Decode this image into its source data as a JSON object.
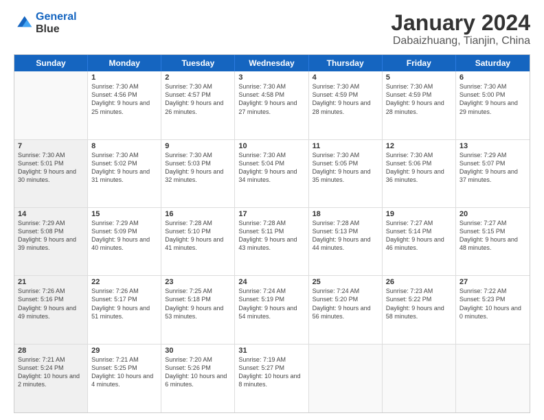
{
  "logo": {
    "line1": "General",
    "line2": "Blue"
  },
  "header": {
    "month": "January 2024",
    "location": "Dabaizhuang, Tianjin, China"
  },
  "weekdays": [
    "Sunday",
    "Monday",
    "Tuesday",
    "Wednesday",
    "Thursday",
    "Friday",
    "Saturday"
  ],
  "weeks": [
    [
      {
        "day": "",
        "sunrise": "",
        "sunset": "",
        "daylight": "",
        "empty": true
      },
      {
        "day": "1",
        "sunrise": "Sunrise: 7:30 AM",
        "sunset": "Sunset: 4:56 PM",
        "daylight": "Daylight: 9 hours and 25 minutes."
      },
      {
        "day": "2",
        "sunrise": "Sunrise: 7:30 AM",
        "sunset": "Sunset: 4:57 PM",
        "daylight": "Daylight: 9 hours and 26 minutes."
      },
      {
        "day": "3",
        "sunrise": "Sunrise: 7:30 AM",
        "sunset": "Sunset: 4:58 PM",
        "daylight": "Daylight: 9 hours and 27 minutes."
      },
      {
        "day": "4",
        "sunrise": "Sunrise: 7:30 AM",
        "sunset": "Sunset: 4:59 PM",
        "daylight": "Daylight: 9 hours and 28 minutes."
      },
      {
        "day": "5",
        "sunrise": "Sunrise: 7:30 AM",
        "sunset": "Sunset: 4:59 PM",
        "daylight": "Daylight: 9 hours and 28 minutes."
      },
      {
        "day": "6",
        "sunrise": "Sunrise: 7:30 AM",
        "sunset": "Sunset: 5:00 PM",
        "daylight": "Daylight: 9 hours and 29 minutes."
      }
    ],
    [
      {
        "day": "7",
        "sunrise": "Sunrise: 7:30 AM",
        "sunset": "Sunset: 5:01 PM",
        "daylight": "Daylight: 9 hours and 30 minutes.",
        "shaded": true
      },
      {
        "day": "8",
        "sunrise": "Sunrise: 7:30 AM",
        "sunset": "Sunset: 5:02 PM",
        "daylight": "Daylight: 9 hours and 31 minutes."
      },
      {
        "day": "9",
        "sunrise": "Sunrise: 7:30 AM",
        "sunset": "Sunset: 5:03 PM",
        "daylight": "Daylight: 9 hours and 32 minutes."
      },
      {
        "day": "10",
        "sunrise": "Sunrise: 7:30 AM",
        "sunset": "Sunset: 5:04 PM",
        "daylight": "Daylight: 9 hours and 34 minutes."
      },
      {
        "day": "11",
        "sunrise": "Sunrise: 7:30 AM",
        "sunset": "Sunset: 5:05 PM",
        "daylight": "Daylight: 9 hours and 35 minutes."
      },
      {
        "day": "12",
        "sunrise": "Sunrise: 7:30 AM",
        "sunset": "Sunset: 5:06 PM",
        "daylight": "Daylight: 9 hours and 36 minutes."
      },
      {
        "day": "13",
        "sunrise": "Sunrise: 7:29 AM",
        "sunset": "Sunset: 5:07 PM",
        "daylight": "Daylight: 9 hours and 37 minutes."
      }
    ],
    [
      {
        "day": "14",
        "sunrise": "Sunrise: 7:29 AM",
        "sunset": "Sunset: 5:08 PM",
        "daylight": "Daylight: 9 hours and 39 minutes.",
        "shaded": true
      },
      {
        "day": "15",
        "sunrise": "Sunrise: 7:29 AM",
        "sunset": "Sunset: 5:09 PM",
        "daylight": "Daylight: 9 hours and 40 minutes."
      },
      {
        "day": "16",
        "sunrise": "Sunrise: 7:28 AM",
        "sunset": "Sunset: 5:10 PM",
        "daylight": "Daylight: 9 hours and 41 minutes."
      },
      {
        "day": "17",
        "sunrise": "Sunrise: 7:28 AM",
        "sunset": "Sunset: 5:11 PM",
        "daylight": "Daylight: 9 hours and 43 minutes."
      },
      {
        "day": "18",
        "sunrise": "Sunrise: 7:28 AM",
        "sunset": "Sunset: 5:13 PM",
        "daylight": "Daylight: 9 hours and 44 minutes."
      },
      {
        "day": "19",
        "sunrise": "Sunrise: 7:27 AM",
        "sunset": "Sunset: 5:14 PM",
        "daylight": "Daylight: 9 hours and 46 minutes."
      },
      {
        "day": "20",
        "sunrise": "Sunrise: 7:27 AM",
        "sunset": "Sunset: 5:15 PM",
        "daylight": "Daylight: 9 hours and 48 minutes."
      }
    ],
    [
      {
        "day": "21",
        "sunrise": "Sunrise: 7:26 AM",
        "sunset": "Sunset: 5:16 PM",
        "daylight": "Daylight: 9 hours and 49 minutes.",
        "shaded": true
      },
      {
        "day": "22",
        "sunrise": "Sunrise: 7:26 AM",
        "sunset": "Sunset: 5:17 PM",
        "daylight": "Daylight: 9 hours and 51 minutes."
      },
      {
        "day": "23",
        "sunrise": "Sunrise: 7:25 AM",
        "sunset": "Sunset: 5:18 PM",
        "daylight": "Daylight: 9 hours and 53 minutes."
      },
      {
        "day": "24",
        "sunrise": "Sunrise: 7:24 AM",
        "sunset": "Sunset: 5:19 PM",
        "daylight": "Daylight: 9 hours and 54 minutes."
      },
      {
        "day": "25",
        "sunrise": "Sunrise: 7:24 AM",
        "sunset": "Sunset: 5:20 PM",
        "daylight": "Daylight: 9 hours and 56 minutes."
      },
      {
        "day": "26",
        "sunrise": "Sunrise: 7:23 AM",
        "sunset": "Sunset: 5:22 PM",
        "daylight": "Daylight: 9 hours and 58 minutes."
      },
      {
        "day": "27",
        "sunrise": "Sunrise: 7:22 AM",
        "sunset": "Sunset: 5:23 PM",
        "daylight": "Daylight: 10 hours and 0 minutes."
      }
    ],
    [
      {
        "day": "28",
        "sunrise": "Sunrise: 7:21 AM",
        "sunset": "Sunset: 5:24 PM",
        "daylight": "Daylight: 10 hours and 2 minutes.",
        "shaded": true
      },
      {
        "day": "29",
        "sunrise": "Sunrise: 7:21 AM",
        "sunset": "Sunset: 5:25 PM",
        "daylight": "Daylight: 10 hours and 4 minutes."
      },
      {
        "day": "30",
        "sunrise": "Sunrise: 7:20 AM",
        "sunset": "Sunset: 5:26 PM",
        "daylight": "Daylight: 10 hours and 6 minutes."
      },
      {
        "day": "31",
        "sunrise": "Sunrise: 7:19 AM",
        "sunset": "Sunset: 5:27 PM",
        "daylight": "Daylight: 10 hours and 8 minutes."
      },
      {
        "day": "",
        "sunrise": "",
        "sunset": "",
        "daylight": "",
        "empty": true
      },
      {
        "day": "",
        "sunrise": "",
        "sunset": "",
        "daylight": "",
        "empty": true
      },
      {
        "day": "",
        "sunrise": "",
        "sunset": "",
        "daylight": "",
        "empty": true
      }
    ]
  ]
}
